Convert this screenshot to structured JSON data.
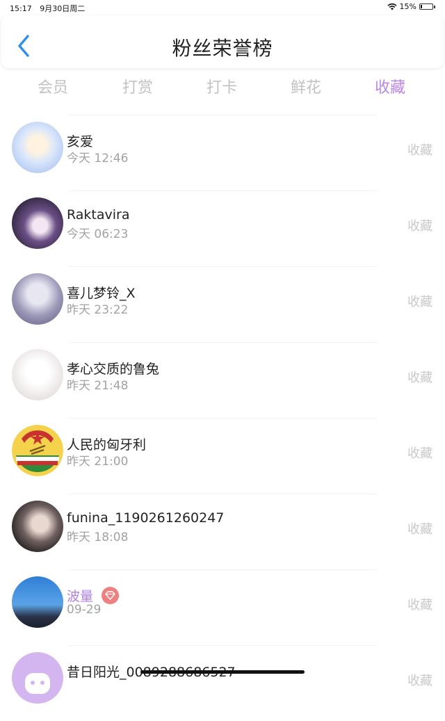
{
  "status_bar": {
    "time": "15:17",
    "date": "9月30日周二",
    "battery_percent": "15%",
    "battery_level": 0.15
  },
  "header": {
    "title": "粉丝荣誉榜",
    "back_icon": "chevron-left-icon"
  },
  "tabs": [
    {
      "label": "会员",
      "active": false
    },
    {
      "label": "打赏",
      "active": false
    },
    {
      "label": "打卡",
      "active": false
    },
    {
      "label": "鲜花",
      "active": false
    },
    {
      "label": "收藏",
      "active": true
    }
  ],
  "fans": [
    {
      "name": "亥爱",
      "time": "今天 12:46",
      "action": "收藏",
      "vip": false
    },
    {
      "name": "Raktavira",
      "time": "今天 06:23",
      "action": "收藏",
      "vip": false
    },
    {
      "name": "喜儿梦铃_X",
      "time": "昨天 23:22",
      "action": "收藏",
      "vip": false
    },
    {
      "name": "孝心交质的鲁兔",
      "time": "昨天 21:48",
      "action": "收藏",
      "vip": false
    },
    {
      "name": "人民的匈牙利",
      "time": "昨天 21:00",
      "action": "收藏",
      "vip": false
    },
    {
      "name": "funina_1190261260247",
      "time": "昨天 18:08",
      "action": "收藏",
      "vip": false
    },
    {
      "name": "波量",
      "time": "09-29",
      "action": "收藏",
      "vip": true
    },
    {
      "name": "昔日阳光_0089288686527",
      "time": "",
      "action": "收藏",
      "vip": false
    }
  ],
  "colors": {
    "accent": "#bb86e8",
    "vip_name": "#b07fe6",
    "vip_badge": "#f08080",
    "inactive_tab": "#c2c2c2"
  }
}
